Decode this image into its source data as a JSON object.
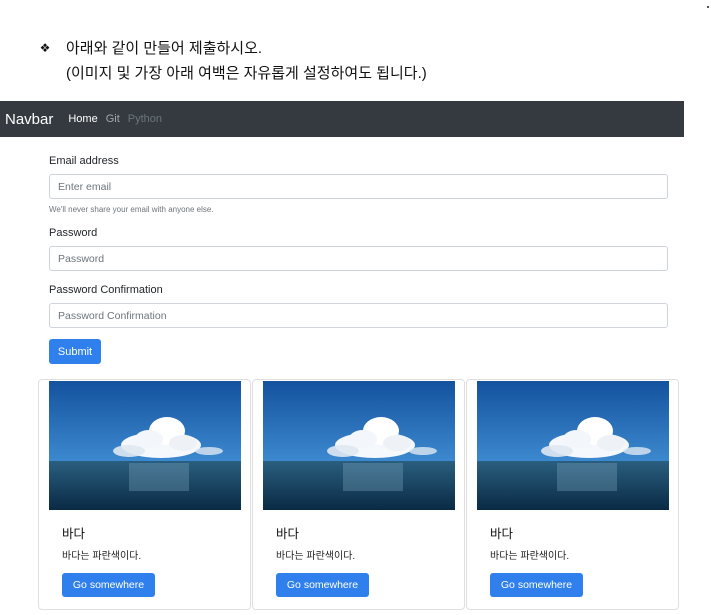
{
  "instructions": {
    "bullet": "❖",
    "line1": "아래와 같이 만들어 제출하시오.",
    "line2": "(이미지 및 가장 아래 여백은 자유롭게 설정하여도 됩니다.)"
  },
  "navbar": {
    "brand": "Navbar",
    "links": [
      {
        "label": "Home",
        "state": "active"
      },
      {
        "label": "Git",
        "state": "inactive"
      },
      {
        "label": "Python",
        "state": "disabled"
      }
    ]
  },
  "form": {
    "email_label": "Email address",
    "email_placeholder": "Enter email",
    "email_help": "We'll never share your email with anyone else.",
    "password_label": "Password",
    "password_placeholder": "Password",
    "confirm_label": "Password Confirmation",
    "confirm_placeholder": "Password Confirmation",
    "submit_label": "Submit"
  },
  "cards": [
    {
      "image": "ocean-clouds-photo",
      "title": "바다",
      "text": "바다는 파란색이다.",
      "button": "Go somewhere"
    },
    {
      "image": "ocean-clouds-photo",
      "title": "바다",
      "text": "바다는 파란색이다.",
      "button": "Go somewhere"
    },
    {
      "image": "ocean-clouds-photo",
      "title": "바다",
      "text": "바다는 파란색이다.",
      "button": "Go somewhere"
    }
  ],
  "colors": {
    "navbar_bg": "#343a40",
    "primary": "#2f80ed",
    "sky": "#1f5fae",
    "sea": "#0d3b5c"
  }
}
